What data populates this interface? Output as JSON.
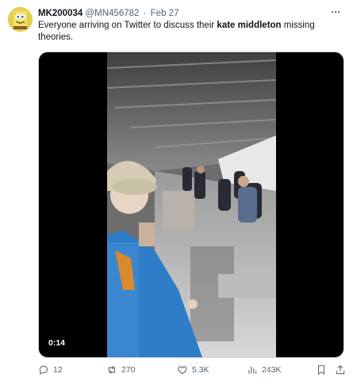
{
  "tweet": {
    "display_name": "MK200034",
    "handle": "@MN456782",
    "separator": "·",
    "date": "Feb 27",
    "text_before": "Everyone arriving on Twitter to discuss their ",
    "text_bold": "kate middleton",
    "text_after": " missing theories.",
    "avatar_icon": "cartoon-sponge-avatar",
    "more_icon": "more-dots-icon"
  },
  "media": {
    "type": "video",
    "duration": "0:14",
    "description_icon": "video-thumbnail"
  },
  "actions": {
    "replies": "12",
    "retweets": "270",
    "likes": "5.3K",
    "views": "243K",
    "reply_icon": "reply-icon",
    "retweet_icon": "retweet-icon",
    "like_icon": "heart-icon",
    "views_icon": "views-bar-chart-icon",
    "bookmark_icon": "bookmark-icon",
    "share_icon": "share-icon"
  },
  "colors": {
    "text_primary": "#0f1419",
    "text_secondary": "#536471",
    "media_background": "#000000"
  }
}
